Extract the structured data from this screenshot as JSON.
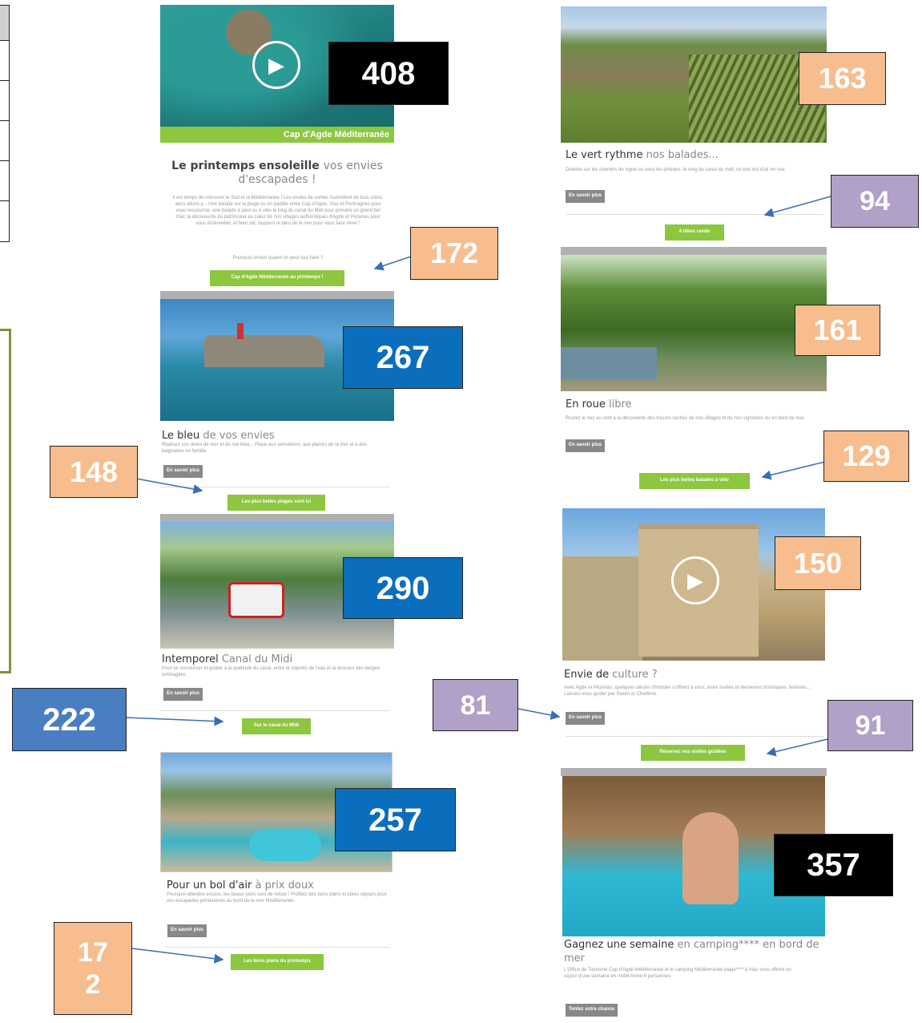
{
  "left_panel": {
    "table_rows": 5
  },
  "colors": {
    "brand_green": "#8dc63f",
    "badge_orange": "#f7bd8e",
    "badge_blue": "#0a6ebd",
    "badge_purple": "#b1a0c8",
    "badge_black": "#000000"
  },
  "email_left": {
    "hero": {
      "play_icon": "play-icon",
      "brand": "Cap d'Agde Méditerranée"
    },
    "intro": {
      "title_main": "Le printemps ensoleille",
      "title_accent": "vos envies d'escapades !",
      "body": "Il est temps de retrouver le Sud et la Méditerranée ! Les envies de sorties fourmillent de tous côtés, alors allons-y... Une balade sur la plage ou en paddle entre Cap d'Agde, Vias et Portiragnes pour vous ressourcer, une balade à pied ou à vélo le long du canal du Midi pour prendre un grand bol d'air, la découverte du patrimoine au cœur de nos villages authentiques d'Agde et Pézenas pour vous émerveiller, et bien sûr, toujours le bleu de la mer pour vous faire rêver !",
      "question": "Pourquoi choisir quand on peut tout faire ?",
      "cta": "Cap d'Agde Méditerranée au printemps !"
    },
    "blocks": [
      {
        "title_main": "Le bleu",
        "title_accent": "de vos envies",
        "body": "Réalisez vos rêves de mer et de ciel bleu... Place aux sensations, aux plaisirs de la mer et à des baignades en famille.",
        "more": "En savoir plus",
        "cta": "Les plus belles plages sont ici"
      },
      {
        "title_main": "Intemporel",
        "title_accent": "Canal du Midi",
        "body": "Pour se ressourcer et goûter à la quiétude du canal, entre le clapotis de l'eau et la douceur des berges ombragées.",
        "more": "En savoir plus",
        "cta": "Sur le canal du Midi"
      },
      {
        "title_main": "Pour un bol d'air",
        "title_accent": "à prix doux",
        "body": "Pourquoi attendre encore, les beaux jours sont de retour ! Profitez des bons plans et idées séjours pour vos escapades printanières au bord de la mer Méditerranée.",
        "more": "En savoir plus",
        "cta": "Les bons plans du printemps"
      }
    ]
  },
  "email_right": {
    "blocks": [
      {
        "title_main": "Le vert rythme",
        "title_accent": "nos balades...",
        "body": "Détente sur les chemins de vigne ou sous les pinèdes, le long du canal du midi, un bon bol d'air en vue.",
        "more": "En savoir plus",
        "cta": "4 idées rando"
      },
      {
        "title_main": "En roue",
        "title_accent": "libre",
        "body": "Roulez le nez au vent à la découverte des trésors cachés de nos villages et de nos vignobles ou en bord de mer.",
        "more": "En savoir plus",
        "cta": "Les plus belles balades à vélo"
      },
      {
        "title_main": "Envie de",
        "title_accent": "culture ?",
        "body": "Avec Agde et Pézenas, quelques siècles d'histoire s'offrent à vous, entre ruelles et demeures historiques, festivals... Laissez-vous guider par Sworn et Charlène.",
        "more": "En savoir plus",
        "cta": "Réservez vos visites guidées"
      },
      {
        "title_main": "Gagnez une semaine",
        "title_accent": "en camping**** en bord de mer",
        "body": "L'Office de Tourisme Cap d'Agde Méditerranée et le camping Méditerranée plage**** à Vias vous offrent un séjour d'une semaine en mobil-home 6 personnes.",
        "cta": "Tentez votre chance"
      }
    ]
  },
  "badges": {
    "hero": "408",
    "intro_cta": "172",
    "bleu_img": "267",
    "bleu_cta": "148",
    "canal_img": "290",
    "canal_cta": "222",
    "camp_img": "257",
    "camp_cta": "17\n2",
    "vert_img": "163",
    "vert_more": "94",
    "roue_img": "161",
    "roue_cta": "129",
    "culture_img": "150",
    "culture_more": "81",
    "culture_cta": "91",
    "contest_img": "357"
  }
}
